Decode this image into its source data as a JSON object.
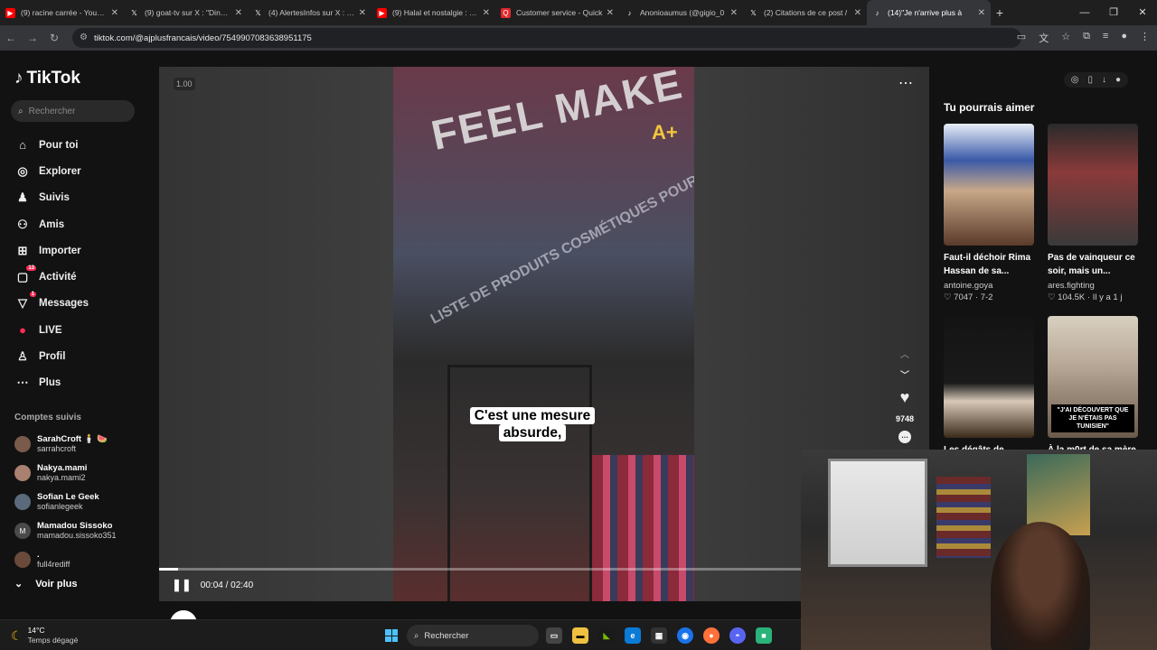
{
  "browser": {
    "tabs": [
      {
        "title": "(9) racine carrée - YouTube",
        "icon": "youtube-icon",
        "color": "#ff0000"
      },
      {
        "title": "(9) goat-tv sur X : \"Dingue",
        "icon": "x-icon",
        "color": "#ffffff"
      },
      {
        "title": "(4) AlertesInfos sur X : \"Il y",
        "icon": "x-icon",
        "color": "#ffffff"
      },
      {
        "title": "(9) Halal et nostalgie : Qu",
        "icon": "youtube-icon",
        "color": "#ff0000"
      },
      {
        "title": "Customer service - Quick",
        "icon": "quick-icon",
        "color": "#e3262e"
      },
      {
        "title": "Anonioaumus (@gigio_0",
        "icon": "tiktok-icon",
        "color": "#ffffff"
      },
      {
        "title": "(2) Citations de ce post /",
        "icon": "x-icon",
        "color": "#ffffff"
      },
      {
        "title": "(14)\"Je n'arrive plus à",
        "icon": "tiktok-icon",
        "color": "#ffffff",
        "active": true
      }
    ],
    "url": "tiktok.com/@ajplusfrancais/video/7549907083638951175"
  },
  "tiktok": {
    "logo": "TikTok",
    "search_placeholder": "Rechercher",
    "nav": [
      {
        "label": "Pour toi",
        "icon": "home-icon"
      },
      {
        "label": "Explorer",
        "icon": "compass-icon"
      },
      {
        "label": "Suivis",
        "icon": "following-icon"
      },
      {
        "label": "Amis",
        "icon": "friends-icon"
      },
      {
        "label": "Importer",
        "icon": "upload-icon"
      },
      {
        "label": "Activité",
        "icon": "activity-icon",
        "badge": "13"
      },
      {
        "label": "Messages",
        "icon": "messages-icon",
        "badge": "1"
      },
      {
        "label": "LIVE",
        "icon": "live-icon"
      },
      {
        "label": "Profil",
        "icon": "profile-icon"
      },
      {
        "label": "Plus",
        "icon": "more-icon"
      }
    ],
    "following_title": "Comptes suivis",
    "following": [
      {
        "name": "SarahCroft 🕯️ 🍉",
        "handle": "sarrahcroft"
      },
      {
        "name": "Nakya.mami",
        "handle": "nakya.mami2"
      },
      {
        "name": "Sofian Le Geek",
        "handle": "sofianlegeek"
      },
      {
        "name": "Mamadou Sissoko",
        "handle": "mamadou.sissoko351",
        "initial": "M"
      },
      {
        "name": ".",
        "handle": "full4rediff"
      }
    ],
    "see_more": "Voir plus"
  },
  "video": {
    "speed": "1.00",
    "sign_text": "FEEL MAKE",
    "sign_sub": "LISTE DE PRODUITS COSMÉTIQUES POUR CORPS",
    "watermark": "A+",
    "subtitle_line1": "C'est une mesure",
    "subtitle_line2": "absurde,",
    "time": "00:04 / 02:40",
    "progress": 0.025,
    "likes": "9748",
    "author": "ajplusfrancais"
  },
  "recommendations": {
    "title": "Tu pourrais aimer",
    "cards": [
      {
        "title": "Faut-il déchoir Rima Hassan de sa...",
        "user": "antoine.goya",
        "stats": "♡ 7047 · 7-2"
      },
      {
        "title": "Pas de vainqueur ce soir, mais un...",
        "user": "ares.fighting",
        "stats": "♡ 104.5K · Il y a 1 j"
      },
      {
        "title": "Les dégâts de",
        "user": "",
        "stats": ""
      },
      {
        "title": "À la m0rt de sa mère",
        "user": "",
        "stats": "",
        "overlay": "\"J'AI DÉCOUVERT QUE JE N'ÉTAIS PAS TUNISIEN\""
      }
    ]
  },
  "taskbar": {
    "temp": "14°C",
    "weather": "Temps dégagé",
    "search": "Rechercher"
  }
}
